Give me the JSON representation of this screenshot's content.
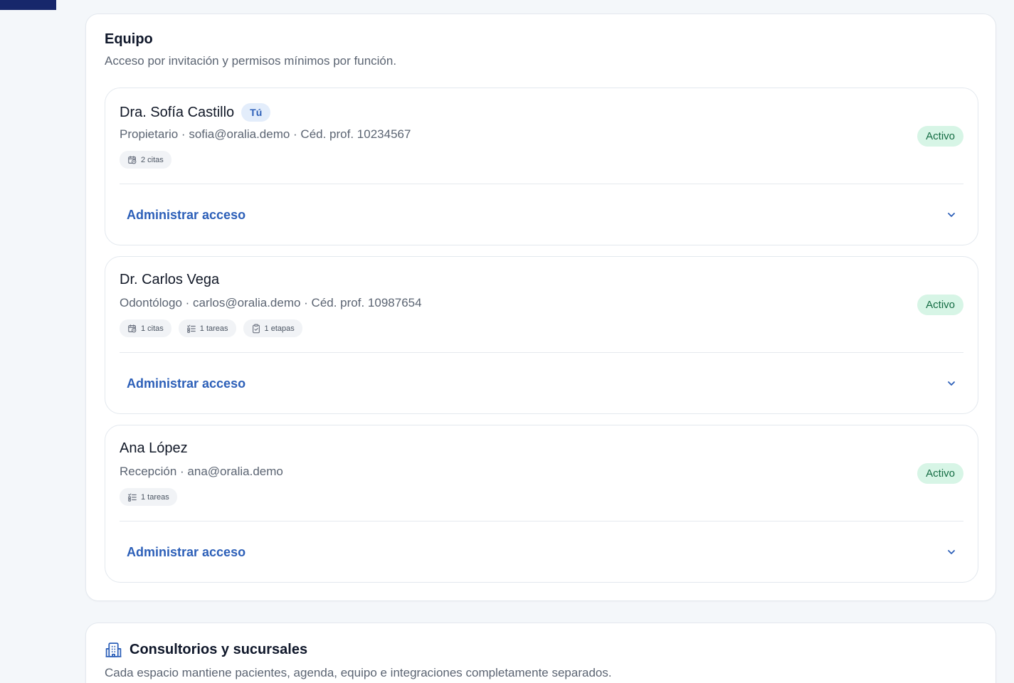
{
  "team": {
    "title": "Equipo",
    "subtitle": "Acceso por invitación y permisos mínimos por función.",
    "manage_label": "Administrar acceso",
    "members": [
      {
        "name": "Dra. Sofía Castillo",
        "badge": "Tú",
        "meta": "Propietario · sofia@oralia.demo · Céd. prof. 10234567",
        "status": "Activo",
        "chips": [
          {
            "icon": "calendar-clock-icon",
            "label": "2 citas"
          }
        ]
      },
      {
        "name": "Dr. Carlos Vega",
        "meta": "Odontólogo · carlos@oralia.demo · Céd. prof. 10987654",
        "status": "Activo",
        "chips": [
          {
            "icon": "calendar-clock-icon",
            "label": "1 citas"
          },
          {
            "icon": "list-check-icon",
            "label": "1 tareas"
          },
          {
            "icon": "clipboard-check-icon",
            "label": "1 etapas"
          }
        ]
      },
      {
        "name": "Ana López",
        "meta": "Recepción · ana@oralia.demo",
        "status": "Activo",
        "chips": [
          {
            "icon": "list-check-icon",
            "label": "1 tareas"
          }
        ]
      }
    ]
  },
  "offices": {
    "icon": "building-icon",
    "title": "Consultorios y sucursales",
    "subtitle": "Cada espacio mantiene pacientes, agenda, equipo e integraciones completamente separados."
  },
  "colors": {
    "accent": "#2c5fb8",
    "status_bg": "#d7f5e6",
    "status_text": "#146c43",
    "sidebar": "#17276b"
  }
}
